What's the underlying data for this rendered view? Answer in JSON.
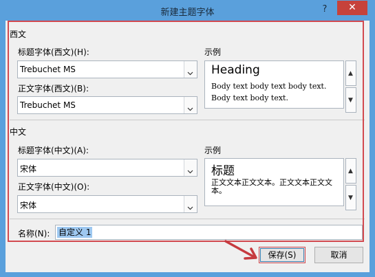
{
  "window": {
    "title": "新建主题字体",
    "help": "?",
    "close": "✕"
  },
  "western": {
    "group_label": "西文",
    "heading_label": "标题字体(西文)(H):",
    "heading_value": "Trebuchet MS",
    "body_label": "正文字体(西文)(B):",
    "body_value": "Trebuchet MS",
    "sample_label": "示例",
    "sample_heading": "Heading",
    "sample_body": "Body text body text body text. Body text body text."
  },
  "chinese": {
    "group_label": "中文",
    "heading_label": "标题字体(中文)(A):",
    "heading_value": "宋体",
    "body_label": "正文字体(中文)(O):",
    "body_value": "宋体",
    "sample_label": "示例",
    "sample_heading": "标题",
    "sample_body": "正文文本正文文本。正文文本正文文本。"
  },
  "name": {
    "label": "名称(N):",
    "value": "自定义 1"
  },
  "buttons": {
    "save": "保存(S)",
    "cancel": "取消"
  },
  "colors": {
    "title_bg": "#5aa0dc",
    "close_bg": "#c6423b",
    "highlight": "#d2494f",
    "selection": "#9ec8f0"
  }
}
